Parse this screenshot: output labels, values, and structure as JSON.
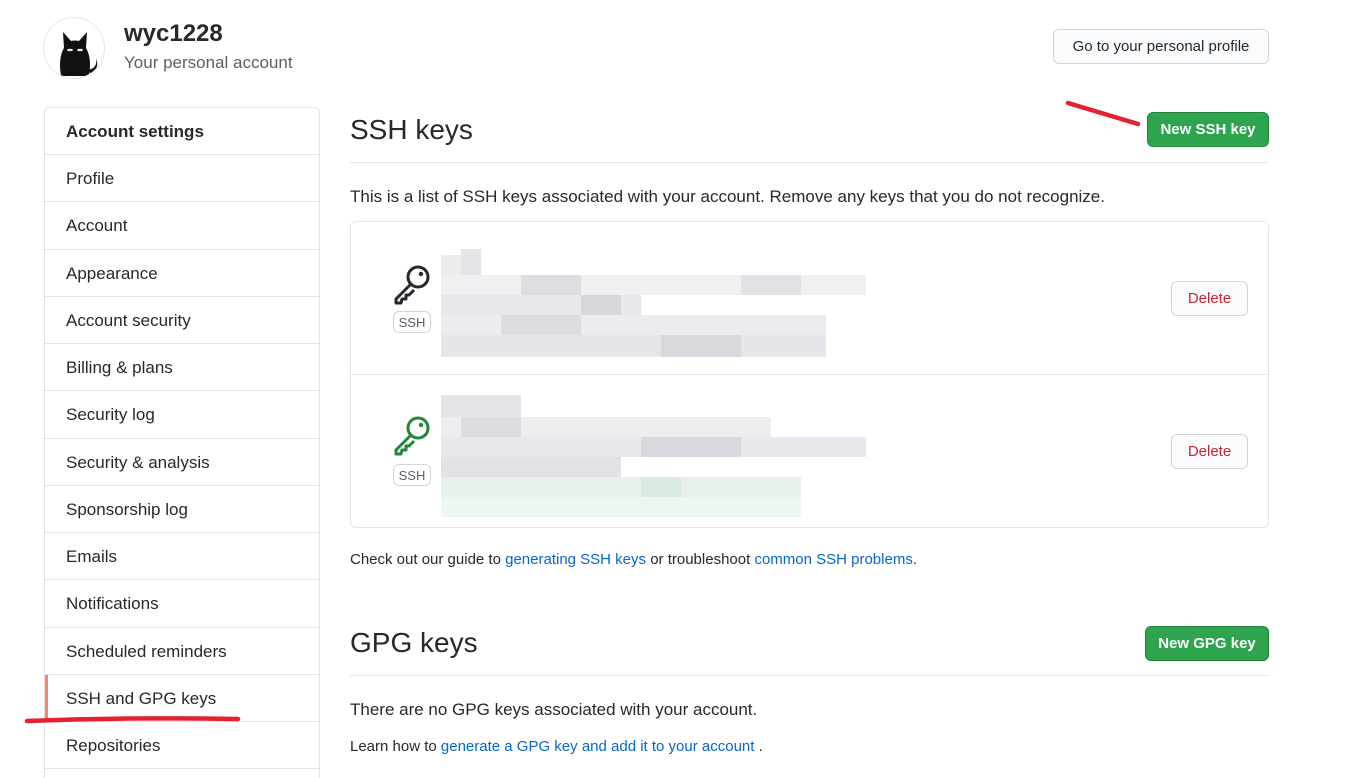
{
  "header": {
    "username": "wyc1228",
    "subtitle": "Your personal account",
    "profile_button": "Go to your personal profile"
  },
  "sidebar": {
    "heading": "Account settings",
    "items": [
      {
        "label": "Profile"
      },
      {
        "label": "Account"
      },
      {
        "label": "Appearance"
      },
      {
        "label": "Account security"
      },
      {
        "label": "Billing & plans"
      },
      {
        "label": "Security log"
      },
      {
        "label": "Security & analysis"
      },
      {
        "label": "Sponsorship log"
      },
      {
        "label": "Emails"
      },
      {
        "label": "Notifications"
      },
      {
        "label": "Scheduled reminders"
      },
      {
        "label": "SSH and GPG keys",
        "selected": true
      },
      {
        "label": "Repositories"
      }
    ]
  },
  "ssh": {
    "title": "SSH keys",
    "new_button": "New SSH key",
    "description": "This is a list of SSH keys associated with your account. Remove any keys that you do not recognize.",
    "keys": [
      {
        "badge": "SSH",
        "delete_label": "Delete",
        "icon": "key-icon",
        "icon_color": "#24292e"
      },
      {
        "badge": "SSH",
        "delete_label": "Delete",
        "icon": "key-icon",
        "icon_color": "#22863a"
      }
    ],
    "guide": {
      "prefix": "Check out our guide to ",
      "link1": "generating SSH keys",
      "middle": " or troubleshoot ",
      "link2": "common SSH problems",
      "suffix": "."
    }
  },
  "gpg": {
    "title": "GPG keys",
    "new_button": "New GPG key",
    "empty": "There are no GPG keys associated with your account.",
    "learn": {
      "prefix": "Learn how to ",
      "link": "generate a GPG key and add it to your account",
      "suffix": " ."
    }
  },
  "colors": {
    "accent_green": "#2ea44f",
    "link_blue": "#0366d6",
    "danger_red": "#cb2431",
    "selected_bar": "#f9826c",
    "annotation_red": "#e3212f"
  }
}
